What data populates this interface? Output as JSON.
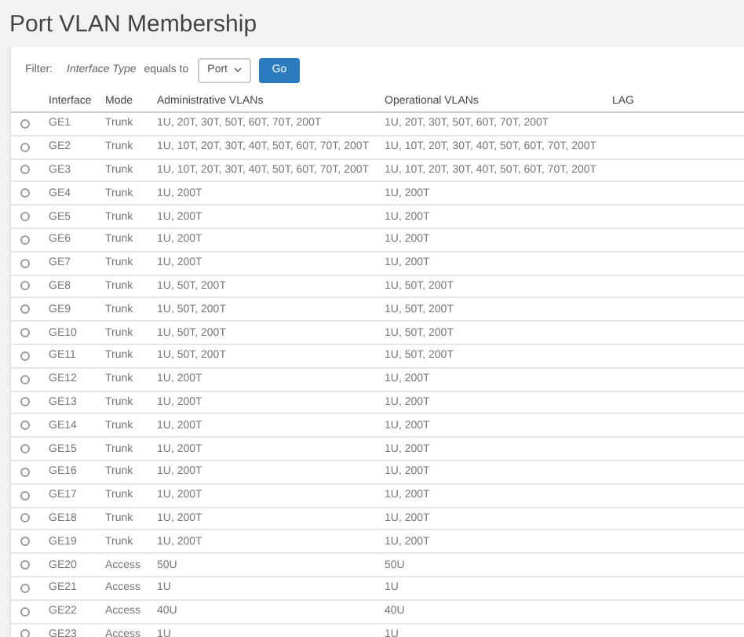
{
  "title": "Port VLAN Membership",
  "filter": {
    "label": "Filter:",
    "field": "Interface Type",
    "operator": "equals to",
    "value": "Port",
    "button": "Go"
  },
  "table": {
    "columns": [
      "Interface",
      "Mode",
      "Administrative VLANs",
      "Operational VLANs",
      "LAG"
    ],
    "rows": [
      {
        "selected": false,
        "interface": "GE1",
        "mode": "Trunk",
        "admin": "1U, 20T, 30T, 50T, 60T, 70T, 200T",
        "oper": "1U, 20T, 30T, 50T, 60T, 70T, 200T"
      },
      {
        "selected": false,
        "interface": "GE2",
        "mode": "Trunk",
        "admin": "1U, 10T, 20T, 30T, 40T, 50T, 60T, 70T, 200T",
        "oper": "1U, 10T, 20T, 30T, 40T, 50T, 60T, 70T, 200T"
      },
      {
        "selected": false,
        "interface": "GE3",
        "mode": "Trunk",
        "admin": "1U, 10T, 20T, 30T, 40T, 50T, 60T, 70T, 200T",
        "oper": "1U, 10T, 20T, 30T, 40T, 50T, 60T, 70T, 200T"
      },
      {
        "selected": false,
        "interface": "GE4",
        "mode": "Trunk",
        "admin": "1U, 200T",
        "oper": "1U, 200T"
      },
      {
        "selected": false,
        "interface": "GE5",
        "mode": "Trunk",
        "admin": "1U, 200T",
        "oper": "1U, 200T"
      },
      {
        "selected": false,
        "interface": "GE6",
        "mode": "Trunk",
        "admin": "1U, 200T",
        "oper": "1U, 200T"
      },
      {
        "selected": false,
        "interface": "GE7",
        "mode": "Trunk",
        "admin": "1U, 200T",
        "oper": "1U, 200T"
      },
      {
        "selected": false,
        "interface": "GE8",
        "mode": "Trunk",
        "admin": "1U, 50T, 200T",
        "oper": "1U, 50T, 200T"
      },
      {
        "selected": false,
        "interface": "GE9",
        "mode": "Trunk",
        "admin": "1U, 50T, 200T",
        "oper": "1U, 50T, 200T"
      },
      {
        "selected": false,
        "interface": "GE10",
        "mode": "Trunk",
        "admin": "1U, 50T, 200T",
        "oper": "1U, 50T, 200T"
      },
      {
        "selected": false,
        "interface": "GE11",
        "mode": "Trunk",
        "admin": "1U, 50T, 200T",
        "oper": "1U, 50T, 200T"
      },
      {
        "selected": false,
        "interface": "GE12",
        "mode": "Trunk",
        "admin": "1U, 200T",
        "oper": "1U, 200T"
      },
      {
        "selected": false,
        "interface": "GE13",
        "mode": "Trunk",
        "admin": "1U, 200T",
        "oper": "1U, 200T"
      },
      {
        "selected": false,
        "interface": "GE14",
        "mode": "Trunk",
        "admin": "1U, 200T",
        "oper": "1U, 200T"
      },
      {
        "selected": false,
        "interface": "GE15",
        "mode": "Trunk",
        "admin": "1U, 200T",
        "oper": "1U, 200T"
      },
      {
        "selected": false,
        "interface": "GE16",
        "mode": "Trunk",
        "admin": "1U, 200T",
        "oper": "1U, 200T"
      },
      {
        "selected": false,
        "interface": "GE17",
        "mode": "Trunk",
        "admin": "1U, 200T",
        "oper": "1U, 200T"
      },
      {
        "selected": false,
        "interface": "GE18",
        "mode": "Trunk",
        "admin": "1U, 200T",
        "oper": "1U, 200T"
      },
      {
        "selected": false,
        "interface": "GE19",
        "mode": "Trunk",
        "admin": "1U, 200T",
        "oper": "1U, 200T"
      },
      {
        "selected": false,
        "interface": "GE20",
        "mode": "Access",
        "admin": "50U",
        "oper": "50U"
      },
      {
        "selected": false,
        "interface": "GE21",
        "mode": "Access",
        "admin": "1U",
        "oper": "1U"
      },
      {
        "selected": false,
        "interface": "GE22",
        "mode": "Access",
        "admin": "40U",
        "oper": "40U"
      },
      {
        "selected": false,
        "interface": "GE23",
        "mode": "Access",
        "admin": "1U",
        "oper": "1U"
      }
    ]
  }
}
